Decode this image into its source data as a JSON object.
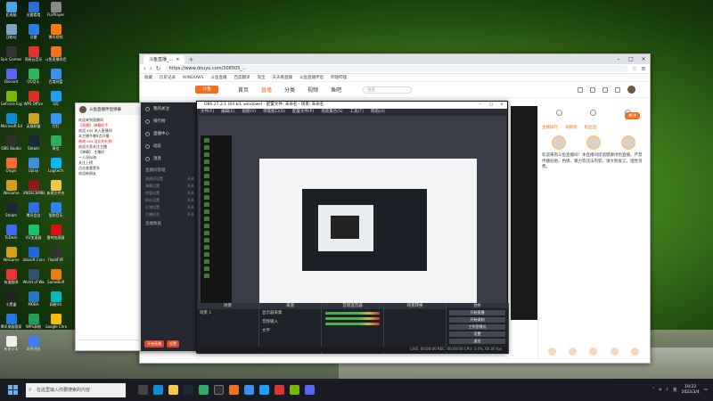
{
  "desktop_icons": [
    {
      "label": "此电脑",
      "color": "#4aa3e8"
    },
    {
      "label": "迅雷看看",
      "color": "#2d6fd6"
    },
    {
      "label": "FLVPlayer",
      "color": "#888"
    },
    {
      "label": "回收站",
      "color": "#7aa7c7"
    },
    {
      "label": "迅雷",
      "color": "#2a7de1"
    },
    {
      "label": "腾讯视频",
      "color": "#ff7a00"
    },
    {
      "label": "Epic Games Launcher",
      "color": "#333"
    },
    {
      "label": "网易云音乐",
      "color": "#d33"
    },
    {
      "label": "斗鱼直播伴侣",
      "color": "#f36f21"
    },
    {
      "label": "Discord",
      "color": "#5865f2"
    },
    {
      "label": "QQ音乐",
      "color": "#2eb55f"
    },
    {
      "label": "百度网盘",
      "color": "#3b8ef5"
    },
    {
      "label": "GeForce Experience",
      "color": "#76b900"
    },
    {
      "label": "WPS Office",
      "color": "#d93025"
    },
    {
      "label": "QQ",
      "color": "#1e9fff"
    },
    {
      "label": "Microsoft Edge",
      "color": "#0f8bd6"
    },
    {
      "label": "英雄联盟",
      "color": "#c9a227"
    },
    {
      "label": "钉钉",
      "color": "#3296fa"
    },
    {
      "label": "OBS Studio",
      "color": "#302e31"
    },
    {
      "label": "Steam",
      "color": "#1b2838"
    },
    {
      "label": "微信",
      "color": "#2aae67"
    },
    {
      "label": "Origin",
      "color": "#f56c2d"
    },
    {
      "label": "Uplay",
      "color": "#3c8ee0"
    },
    {
      "label": "Logitech",
      "color": "#00b8fc"
    },
    {
      "label": "WeGame",
      "color": "#d4a017"
    },
    {
      "label": "UNDECEMBER",
      "color": "#8b1a1a"
    },
    {
      "label": "新建文件夹",
      "color": "#f2c84b"
    },
    {
      "label": "Steam",
      "color": "#1b2838"
    },
    {
      "label": "腾讯会议",
      "color": "#2f6fe4"
    },
    {
      "label": "酷狗音乐",
      "color": "#2a86f7"
    },
    {
      "label": "ToDesk",
      "color": "#3c6cf5"
    },
    {
      "label": "UU加速器",
      "color": "#1dbf73"
    },
    {
      "label": "雷神加速器",
      "color": "#d11"
    },
    {
      "label": "WeGame",
      "color": "#d4a017"
    },
    {
      "label": "Ubisoft Connect",
      "color": "#1e6bd6"
    },
    {
      "label": "FlashFXP",
      "color": "#333"
    },
    {
      "label": "有道翻译",
      "color": "#e33"
    },
    {
      "label": "World of Warships",
      "color": "#33506e"
    },
    {
      "label": "GameBuff",
      "color": "#e87d0d"
    },
    {
      "label": "小黑盒",
      "color": "#222"
    },
    {
      "label": "MOBA",
      "color": "#2a75c8"
    },
    {
      "label": "网易UU",
      "color": "#0bb"
    },
    {
      "label": "腾讯电脑管家",
      "color": "#2278e0"
    },
    {
      "label": "WPS表格",
      "color": "#1e9e5a"
    },
    {
      "label": "Google Chrome",
      "color": "#fbbc05"
    },
    {
      "label": "新建文本",
      "color": "#eee"
    },
    {
      "label": "高德地图",
      "color": "#3d7cf2"
    },
    {
      "label": "",
      "color": "transparent"
    }
  ],
  "browser": {
    "tab_title": "斗鱼直播_...",
    "url": "https://www.douyu.com/308505_...",
    "bookmarks": [
      "收藏",
      "历史记录",
      "WINDOWS",
      "斗鱼直播",
      "百度翻译",
      "淘宝",
      "天天看直播",
      "斗鱼直播伴侣",
      "哔哩哔哩"
    ],
    "nav": [
      "首页",
      "直播",
      "分类",
      "视频",
      "鱼吧"
    ],
    "search_placeholder": "搜索",
    "right_tabs": [
      "主播排行",
      "贡献榜",
      "粉丝团"
    ],
    "notice": "欢迎来到斗鱼直播间！本直播间提倡健康绿色直播，严禁传播低俗、色情、暴力等违法内容，请文明发言，理性消费。",
    "follow_label": "关注"
  },
  "obs": {
    "title": "OBS 27.2.1 (64 bit, windows) - 配置文件: 未命名 - 场景: 未命名",
    "menu": [
      "文件(F)",
      "编辑(E)",
      "视图(V)",
      "停靠窗口(D)",
      "配置文件(P)",
      "场景集合(S)",
      "工具(T)",
      "帮助(H)"
    ],
    "docks": [
      "场景",
      "来源",
      "音频混音器",
      "场景转换",
      "控件"
    ],
    "scene": "场景 1",
    "sources": [
      "显示器采集",
      "音频输入",
      "文字"
    ],
    "controls": [
      "开始直播",
      "开始录制",
      "工作室模式",
      "设置",
      "退出"
    ],
    "status": "LIVE: 00:00:00   REC: 00:00:00   CPU: 3.4%, 60.00 fps"
  },
  "chat": {
    "title": "斗鱼直播伴侣弹幕",
    "lines": [
      "欢迎来到直播间",
      "【直播】 弹幕助手",
      "欢迎 xxx 进入直播间",
      "本主播今晚8点开播",
      "感谢 xxx 送出的礼物",
      "欢迎大家关注主播",
      "【弹幕】 主播好",
      "一入深似海",
      "关注上榜",
      "点击查看更多",
      "欢迎新朋友"
    ]
  },
  "sidebar": {
    "items": [
      "我的关注",
      "排行榜",
      "直播中心",
      "动态",
      "消息"
    ],
    "section": "直播间管理",
    "lines": [
      [
        "直播间设置",
        "开关"
      ],
      [
        "弹幕设置",
        "开关"
      ],
      [
        "房管设置",
        "开关"
      ],
      [
        "粉丝设置",
        "开关"
      ],
      [
        "礼物设置",
        "开关"
      ],
      [
        "主播任务",
        "开关"
      ]
    ],
    "section2": "直播数据",
    "buttons": [
      "开始直播",
      "设置"
    ]
  },
  "taskbar": {
    "search_placeholder": "在这里输入你要搜索的内容",
    "time": "19:23",
    "date": "2022/3/4",
    "lang": "英"
  }
}
